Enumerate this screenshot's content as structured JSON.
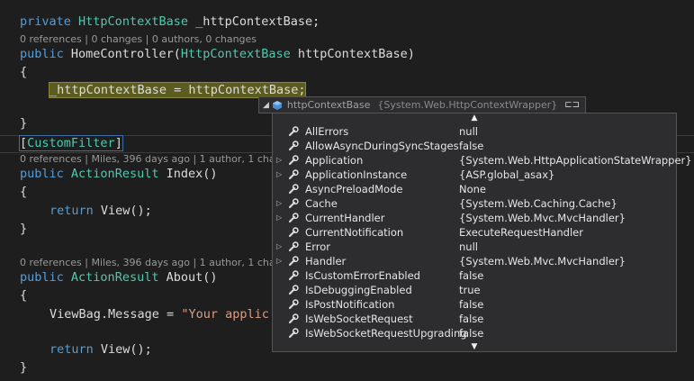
{
  "code": {
    "l1": {
      "kw": "private",
      "ty": "HttpContextBase",
      "rest": " _httpContextBase;"
    },
    "lens1": "0 references | 0 changes | 0 authors, 0 changes",
    "l2": {
      "kw": "public",
      "name": " HomeController(",
      "ty": "HttpContextBase",
      "rest": " httpContextBase)"
    },
    "brace_open": "{",
    "l3_highlight": "_httpContextBase = httpContextBase;",
    "brace_close": "}",
    "l4": {
      "open": "[",
      "ty": "CustomFilter",
      "close": "]"
    },
    "lens2": "0 references | Miles, 396 days ago | 1 author, 1 change",
    "l5": {
      "kw": "public",
      "ty": "ActionResult",
      "rest": " Index()"
    },
    "l6": {
      "kw": "return",
      "rest": " View();"
    },
    "lens3": "0 references | Miles, 396 days ago | 1 author, 1 change",
    "l7": {
      "kw": "public",
      "ty": "ActionResult",
      "rest": " About()"
    },
    "l8": {
      "pre": "ViewBag.Message = ",
      "str": "\"Your applic"
    },
    "l9": {
      "kw": "return",
      "rest": " View();"
    }
  },
  "datatip": {
    "name": "httpContextBase",
    "value": "{System.Web.HttpContextWrapper}",
    "rows": [
      {
        "name": "AllErrors",
        "value": "null",
        "expandable": false
      },
      {
        "name": "AllowAsyncDuringSyncStages",
        "value": "false",
        "expandable": false
      },
      {
        "name": "Application",
        "value": "{System.Web.HttpApplicationStateWrapper}",
        "expandable": true
      },
      {
        "name": "ApplicationInstance",
        "value": "{ASP.global_asax}",
        "expandable": true
      },
      {
        "name": "AsyncPreloadMode",
        "value": "None",
        "expandable": false
      },
      {
        "name": "Cache",
        "value": "{System.Web.Caching.Cache}",
        "expandable": true
      },
      {
        "name": "CurrentHandler",
        "value": "{System.Web.Mvc.MvcHandler}",
        "expandable": true
      },
      {
        "name": "CurrentNotification",
        "value": "ExecuteRequestHandler",
        "expandable": false
      },
      {
        "name": "Error",
        "value": "null",
        "expandable": true
      },
      {
        "name": "Handler",
        "value": "{System.Web.Mvc.MvcHandler}",
        "expandable": true
      },
      {
        "name": "IsCustomErrorEnabled",
        "value": "false",
        "expandable": false
      },
      {
        "name": "IsDebuggingEnabled",
        "value": "true",
        "expandable": false
      },
      {
        "name": "IsPostNotification",
        "value": "false",
        "expandable": false
      },
      {
        "name": "IsWebSocketRequest",
        "value": "false",
        "expandable": false
      },
      {
        "name": "IsWebSocketRequestUpgrading",
        "value": "false",
        "expandable": false
      }
    ]
  },
  "icons": {
    "expand": "triangle-right-icon",
    "wrench": "wrench-icon",
    "object": "object-cube-icon",
    "pin": "pin-icon"
  }
}
